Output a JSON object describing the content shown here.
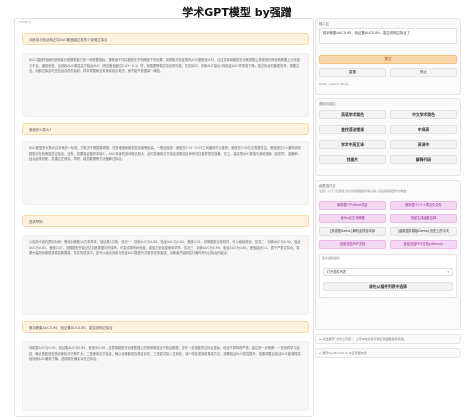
{
  "app": {
    "title": "学术GPT模型 by强蹭"
  },
  "chat": {
    "label": "Chatbot",
    "messages": [
      {
        "role": "user",
        "text": "训练用与验证和正向AUC都值越过准多少说明过拟合"
      },
      {
        "role": "assistant",
        "text": "AUC(曲线的面积)是衡量分类模型能力的一种重要指标，通常用于评估模型在不同阈值下的效果。训练集与验证集的AUC差距较大时，往往意味着模型在训练数据上表现良好而在新数据上泛化能力不足。通常来说，当训练AUC明显高于验证AUC（例如差值超过0.05~0.1）时，就需要警惕过拟合的可能。在实际中，训练AUC接近1而验证AUC停滞或下降，是过拟合的典型信号。需要注意，判断过拟合时还应结合损失曲线、样本规模和业务场景综合考虑，而不能只依据单一阈值。"
      },
      {
        "role": "user",
        "text": "差值多少算大?"
      },
      {
        "role": "assistant",
        "text": "AUC差值多大算大并没有统一标准，它取决于数据集规模、任务难度和模型复杂度等因素。一般经验是：差值在0.01~0.03之间通常可以接受；差值在0.05左右需要关注；差值超过0.1通常说明模型存在较明显的过拟合。此外，如果验证集样本较少，AUC本身的波动就比较大，此时应使用交叉验证或置信区间来评估差异是否显著。总之，建议把AUC差值与其他指标（如损失、准确率）结合起来判断，并通过正则化、早停、增加数据等方法缓解过拟合。"
      },
      {
        "role": "user",
        "text": "具体举例"
      },
      {
        "role": "assistant",
        "text": "以信用卡违约预测为例：假设训练集10万条样本，验证集2万条。情况一：训练AUC为0.86，验证AUC为0.84，差值0.02，说明模型泛化较好，可以继续调优。情况二：训练AUC为0.92，验证AUC为0.85，差值0.07，说明模型开始记忆训练数据中的噪声，可尝试降低树深度、增加正则化或使用早停。情况三：训练AUC为0.99，验证AUC为0.80，差值接近0.2，属于严重过拟合，需要大幅简化模型或增加数据量。在实际项目中，还可以画出训练与验证AUC随迭代次数变化的曲线，当两者开始明显分离时即为过拟合的起点。"
      },
      {
        "role": "user",
        "text": "那训练集AUC0.95，验证集AUC0.89，能否说明过拟合"
      },
      {
        "role": "assistant",
        "text": "训练集AUC为0.95、验证集AUC为0.89，差值为0.06，这表明模型在训练数据上的表现明显优于验证数据，存在一定程度的过拟合迹象，但还不算特别严重。建议进一步观察：一是查看学习曲线，确认差距是否随训练轮次不断扩大；二是使用交叉验证，确认该差距是否稳定存在；三是尝试加入正则化、减少特征或采用集成方法，观察验证AUC是否提升。如果调整后验证AUC能够提高而训练AUC略有下降，说明原先确实存在过拟合。"
      }
    ]
  },
  "panel": {
    "input": {
      "label": "输入区",
      "value": "那训练集AUC0.95，验证集AUC0.89，能否说明过拟合了",
      "submit_label": "提交",
      "reset_label": "重置",
      "stop_label": "停止",
      "status": "finish_reason: None"
    },
    "basic": {
      "label": "基础功能区",
      "buttons": [
        "英语学术润色",
        "中文学术润色",
        "查找语法错误",
        "中译英",
        "学术中英互译",
        "英译中",
        "找图片",
        "解释代码"
      ]
    },
    "plugins": {
      "label": "函数插件区",
      "hint": "注意：以下“红颜色”标识的函数插件需从输入区读取路径作为参数",
      "buttons": [
        "解析整个Python项目",
        "解析整个C++项目头文件",
        "读Tex论文写摘要",
        "批量生成函数注释",
        "[多线程Demo] 解析此项目本身",
        "[函数插件模板Demo] 历史上的今天",
        "批量总结PDF文档",
        "批量总结PDF文档pdfminer"
      ],
      "more_label": "更多函数插件",
      "select_value": "打开插件列表",
      "run_label": "请先从插件列表中选择"
    },
    "upload": {
      "label": "点击展开“文件上传区”，上传本地文件可供红色函数插件调用。"
    },
    "sysprompt": {
      "label": "展开SysPrompt & 交互界面布局"
    }
  }
}
